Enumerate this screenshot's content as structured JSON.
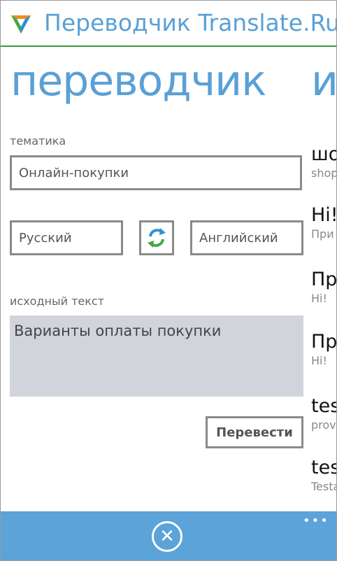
{
  "app": {
    "title": "Переводчик Translate.Ru"
  },
  "pivot": {
    "current": "переводчик",
    "next": "и"
  },
  "translator": {
    "topic_label": "тематика",
    "topic_value": "Онлайн-покупки",
    "source_lang": "Русский",
    "target_lang": "Английский",
    "source_label": "исходный текст",
    "source_text": "Варианты оплаты покупки",
    "translate_button": "Перевести"
  },
  "history": [
    {
      "main": "шо",
      "sub": "shop"
    },
    {
      "main": "Hi!",
      "sub": "При"
    },
    {
      "main": "Пр",
      "sub": "Hi!"
    },
    {
      "main": "Пр",
      "sub": "Hi!"
    },
    {
      "main": "tes",
      "sub": "prov"
    },
    {
      "main": "tes",
      "sub": "Testa"
    }
  ],
  "appbar": {
    "close_icon": "close-icon",
    "more_label": "•••"
  },
  "colors": {
    "accent": "#5aa0d6",
    "appbar": "#5ba3d9",
    "title_underline": "#3a9b3a",
    "source_bg": "#d1d5db"
  }
}
